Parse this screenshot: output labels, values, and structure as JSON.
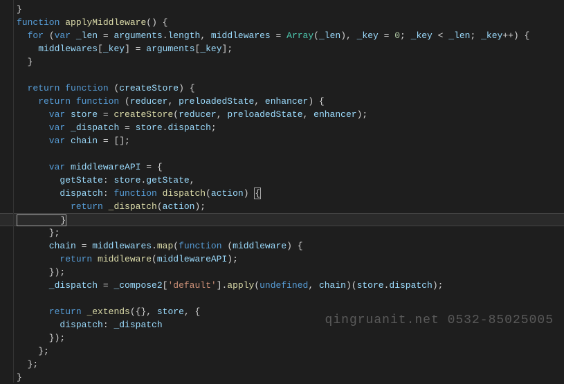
{
  "watermark": "qingruanit.net 0532-85025005",
  "code": {
    "tokens": [
      [
        [
          "pun",
          0,
          "}"
        ]
      ],
      [
        [
          "kw",
          0,
          "function"
        ],
        [
          "pun",
          0,
          " "
        ],
        [
          "fn",
          0,
          "applyMiddleware"
        ],
        [
          "pun",
          0,
          "() {"
        ]
      ],
      [
        [
          "kw",
          1,
          "for"
        ],
        [
          "pun",
          0,
          " ("
        ],
        [
          "kw",
          0,
          "var"
        ],
        [
          "pun",
          0,
          " "
        ],
        [
          "id",
          0,
          "_len"
        ],
        [
          "pun",
          0,
          " = "
        ],
        [
          "id",
          0,
          "arguments"
        ],
        [
          "pun",
          0,
          "."
        ],
        [
          "id",
          0,
          "length"
        ],
        [
          "pun",
          0,
          ", "
        ],
        [
          "id",
          0,
          "middlewares"
        ],
        [
          "pun",
          0,
          " = "
        ],
        [
          "cls",
          0,
          "Array"
        ],
        [
          "pun",
          0,
          "("
        ],
        [
          "id",
          0,
          "_len"
        ],
        [
          "pun",
          0,
          "), "
        ],
        [
          "id",
          0,
          "_key"
        ],
        [
          "pun",
          0,
          " = "
        ],
        [
          "num",
          0,
          "0"
        ],
        [
          "pun",
          0,
          "; "
        ],
        [
          "id",
          0,
          "_key"
        ],
        [
          "pun",
          0,
          " < "
        ],
        [
          "id",
          0,
          "_len"
        ],
        [
          "pun",
          0,
          "; "
        ],
        [
          "id",
          0,
          "_key"
        ],
        [
          "pun",
          0,
          "++) {"
        ]
      ],
      [
        [
          "id",
          2,
          "middlewares"
        ],
        [
          "pun",
          0,
          "["
        ],
        [
          "id",
          0,
          "_key"
        ],
        [
          "pun",
          0,
          "] = "
        ],
        [
          "id",
          0,
          "arguments"
        ],
        [
          "pun",
          0,
          "["
        ],
        [
          "id",
          0,
          "_key"
        ],
        [
          "pun",
          0,
          "];"
        ]
      ],
      [
        [
          "pun",
          1,
          "}"
        ]
      ],
      [],
      [
        [
          "kw",
          1,
          "return"
        ],
        [
          "pun",
          0,
          " "
        ],
        [
          "kw",
          0,
          "function"
        ],
        [
          "pun",
          0,
          " ("
        ],
        [
          "id",
          0,
          "createStore"
        ],
        [
          "pun",
          0,
          ") {"
        ]
      ],
      [
        [
          "kw",
          2,
          "return"
        ],
        [
          "pun",
          0,
          " "
        ],
        [
          "kw",
          0,
          "function"
        ],
        [
          "pun",
          0,
          " ("
        ],
        [
          "id",
          0,
          "reducer"
        ],
        [
          "pun",
          0,
          ", "
        ],
        [
          "id",
          0,
          "preloadedState"
        ],
        [
          "pun",
          0,
          ", "
        ],
        [
          "id",
          0,
          "enhancer"
        ],
        [
          "pun",
          0,
          ") {"
        ]
      ],
      [
        [
          "kw",
          3,
          "var"
        ],
        [
          "pun",
          0,
          " "
        ],
        [
          "id",
          0,
          "store"
        ],
        [
          "pun",
          0,
          " = "
        ],
        [
          "fn",
          0,
          "createStore"
        ],
        [
          "pun",
          0,
          "("
        ],
        [
          "id",
          0,
          "reducer"
        ],
        [
          "pun",
          0,
          ", "
        ],
        [
          "id",
          0,
          "preloadedState"
        ],
        [
          "pun",
          0,
          ", "
        ],
        [
          "id",
          0,
          "enhancer"
        ],
        [
          "pun",
          0,
          ");"
        ]
      ],
      [
        [
          "kw",
          3,
          "var"
        ],
        [
          "pun",
          0,
          " "
        ],
        [
          "id",
          0,
          "_dispatch"
        ],
        [
          "pun",
          0,
          " = "
        ],
        [
          "id",
          0,
          "store"
        ],
        [
          "pun",
          0,
          "."
        ],
        [
          "id",
          0,
          "dispatch"
        ],
        [
          "pun",
          0,
          ";"
        ]
      ],
      [
        [
          "kw",
          3,
          "var"
        ],
        [
          "pun",
          0,
          " "
        ],
        [
          "id",
          0,
          "chain"
        ],
        [
          "pun",
          0,
          " = [];"
        ]
      ],
      [],
      [
        [
          "kw",
          3,
          "var"
        ],
        [
          "pun",
          0,
          " "
        ],
        [
          "id",
          0,
          "middlewareAPI"
        ],
        [
          "pun",
          0,
          " = {"
        ]
      ],
      [
        [
          "id",
          4,
          "getState"
        ],
        [
          "pun",
          0,
          ": "
        ],
        [
          "id",
          0,
          "store"
        ],
        [
          "pun",
          0,
          "."
        ],
        [
          "id",
          0,
          "getState"
        ],
        [
          "pun",
          0,
          ","
        ]
      ],
      [
        [
          "id",
          4,
          "dispatch"
        ],
        [
          "pun",
          0,
          ": "
        ],
        [
          "kw",
          0,
          "function"
        ],
        [
          "pun",
          0,
          " "
        ],
        [
          "fn",
          0,
          "dispatch"
        ],
        [
          "pun",
          0,
          "("
        ],
        [
          "id",
          0,
          "action"
        ],
        [
          "pun",
          0,
          ") "
        ],
        [
          "box",
          0,
          "{"
        ]
      ],
      [
        [
          "kw",
          5,
          "return"
        ],
        [
          "pun",
          0,
          " "
        ],
        [
          "fn",
          0,
          "_dispatch"
        ],
        [
          "pun",
          0,
          "("
        ],
        [
          "id",
          0,
          "action"
        ],
        [
          "pun",
          0,
          ");"
        ]
      ],
      [
        [
          "box",
          4,
          "}"
        ]
      ],
      [
        [
          "pun",
          3,
          "};"
        ]
      ],
      [
        [
          "id",
          3,
          "chain"
        ],
        [
          "pun",
          0,
          " = "
        ],
        [
          "id",
          0,
          "middlewares"
        ],
        [
          "pun",
          0,
          "."
        ],
        [
          "fn",
          0,
          "map"
        ],
        [
          "pun",
          0,
          "("
        ],
        [
          "kw",
          0,
          "function"
        ],
        [
          "pun",
          0,
          " ("
        ],
        [
          "id",
          0,
          "middleware"
        ],
        [
          "pun",
          0,
          ") {"
        ]
      ],
      [
        [
          "kw",
          4,
          "return"
        ],
        [
          "pun",
          0,
          " "
        ],
        [
          "fn",
          0,
          "middleware"
        ],
        [
          "pun",
          0,
          "("
        ],
        [
          "id",
          0,
          "middlewareAPI"
        ],
        [
          "pun",
          0,
          ");"
        ]
      ],
      [
        [
          "pun",
          3,
          "});"
        ]
      ],
      [
        [
          "id",
          3,
          "_dispatch"
        ],
        [
          "pun",
          0,
          " = "
        ],
        [
          "id",
          0,
          "_compose2"
        ],
        [
          "pun",
          0,
          "["
        ],
        [
          "str",
          0,
          "'default'"
        ],
        [
          "pun",
          0,
          "]."
        ],
        [
          "fn",
          0,
          "apply"
        ],
        [
          "pun",
          0,
          "("
        ],
        [
          "kw",
          0,
          "undefined"
        ],
        [
          "pun",
          0,
          ", "
        ],
        [
          "id",
          0,
          "chain"
        ],
        [
          "pun",
          0,
          ")("
        ],
        [
          "id",
          0,
          "store"
        ],
        [
          "pun",
          0,
          "."
        ],
        [
          "id",
          0,
          "dispatch"
        ],
        [
          "pun",
          0,
          ");"
        ]
      ],
      [],
      [
        [
          "kw",
          3,
          "return"
        ],
        [
          "pun",
          0,
          " "
        ],
        [
          "fn",
          0,
          "_extends"
        ],
        [
          "pun",
          0,
          "({}, "
        ],
        [
          "id",
          0,
          "store"
        ],
        [
          "pun",
          0,
          ", {"
        ]
      ],
      [
        [
          "id",
          4,
          "dispatch"
        ],
        [
          "pun",
          0,
          ": "
        ],
        [
          "id",
          0,
          "_dispatch"
        ]
      ],
      [
        [
          "pun",
          3,
          "});"
        ]
      ],
      [
        [
          "pun",
          2,
          "};"
        ]
      ],
      [
        [
          "pun",
          1,
          "};"
        ]
      ],
      [
        [
          "pun",
          0,
          "}"
        ]
      ]
    ],
    "highlight_line": 16
  }
}
